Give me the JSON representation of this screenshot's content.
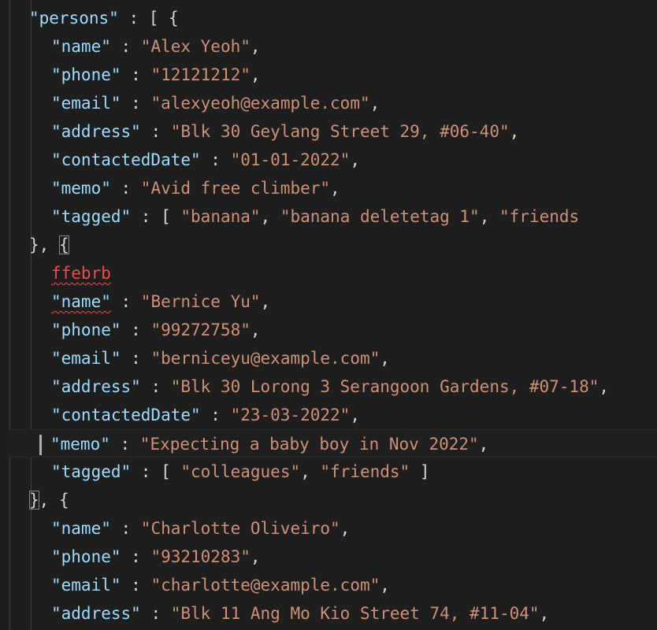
{
  "colors": {
    "background": "#1e1e1e",
    "key": "#9cdcfe",
    "string": "#ce9178",
    "punctuation": "#d4d4d4",
    "error": "#f14c4c"
  },
  "lines": [
    {
      "kind": "key",
      "key": "\"persons\"",
      "sep": " : ",
      "tail": "[ {"
    },
    {
      "kind": "pair",
      "key": "\"name\"",
      "sep": " : ",
      "value": "\"Alex Yeoh\"",
      "end": ","
    },
    {
      "kind": "pair",
      "key": "\"phone\"",
      "sep": " : ",
      "value": "\"12121212\"",
      "end": ","
    },
    {
      "kind": "pair",
      "key": "\"email\"",
      "sep": " : ",
      "value": "\"alexyeoh@example.com\"",
      "end": ","
    },
    {
      "kind": "pair",
      "key": "\"address\"",
      "sep": " : ",
      "value": "\"Blk 30 Geylang Street 29, #06-40\"",
      "end": ","
    },
    {
      "kind": "pair",
      "key": "\"contactedDate\"",
      "sep": " : ",
      "value": "\"01-01-2022\"",
      "end": ","
    },
    {
      "kind": "pair",
      "key": "\"memo\"",
      "sep": " : ",
      "value": "\"Avid free climber\"",
      "end": ","
    },
    {
      "kind": "tags",
      "key": "\"tagged\"",
      "sep": " : ",
      "open": "[ ",
      "items": [
        "\"banana\"",
        "\"banana deletetag 1\"",
        "\"friends"
      ],
      "close": ""
    },
    {
      "kind": "brace",
      "text": "}, ",
      "bracket": "{"
    },
    {
      "kind": "error",
      "text": "ffebrb"
    },
    {
      "kind": "pair-err",
      "key": "\"name\"",
      "sep": " : ",
      "value": "\"Bernice Yu\"",
      "end": ","
    },
    {
      "kind": "pair",
      "key": "\"phone\"",
      "sep": " : ",
      "value": "\"99272758\"",
      "end": ","
    },
    {
      "kind": "pair",
      "key": "\"email\"",
      "sep": " : ",
      "value": "\"berniceyu@example.com\"",
      "end": ","
    },
    {
      "kind": "pair",
      "key": "\"address\"",
      "sep": " : ",
      "value": "\"Blk 30 Lorong 3 Serangoon Gardens, #07-18\"",
      "end": ","
    },
    {
      "kind": "pair",
      "key": "\"contactedDate\"",
      "sep": " : ",
      "value": "\"23-03-2022\"",
      "end": ","
    },
    {
      "kind": "pair-current",
      "key": "\"memo\"",
      "sep": " : ",
      "value": "\"Expecting a baby boy in Nov 2022\"",
      "end": ","
    },
    {
      "kind": "tags",
      "key": "\"tagged\"",
      "sep": " : ",
      "open": "[ ",
      "items": [
        "\"colleagues\"",
        "\"friends\""
      ],
      "close": " ]"
    },
    {
      "kind": "brace2",
      "bracket": "}",
      "text": ", {"
    },
    {
      "kind": "pair",
      "key": "\"name\"",
      "sep": " : ",
      "value": "\"Charlotte Oliveiro\"",
      "end": ","
    },
    {
      "kind": "pair",
      "key": "\"phone\"",
      "sep": " : ",
      "value": "\"93210283\"",
      "end": ","
    },
    {
      "kind": "pair",
      "key": "\"email\"",
      "sep": " : ",
      "value": "\"charlotte@example.com\"",
      "end": ","
    },
    {
      "kind": "pair",
      "key": "\"address\"",
      "sep": " : ",
      "value": "\"Blk 11 Ang Mo Kio Street 74, #11-04\"",
      "end": ","
    }
  ]
}
